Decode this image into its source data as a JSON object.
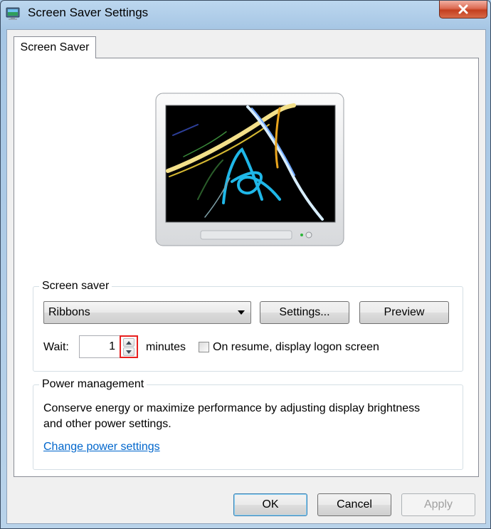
{
  "window": {
    "title": "Screen Saver Settings"
  },
  "tabs": [
    {
      "label": "Screen Saver"
    }
  ],
  "screen_saver": {
    "group_title": "Screen saver",
    "selected": "Ribbons",
    "settings_label": "Settings...",
    "preview_label": "Preview",
    "wait_label": "Wait:",
    "wait_value": "1",
    "minutes_label": "minutes",
    "logon_label": "On resume, display logon screen",
    "logon_checked": false
  },
  "power": {
    "group_title": "Power management",
    "description": "Conserve energy or maximize performance by adjusting display brightness and other power settings.",
    "link_label": "Change power settings"
  },
  "buttons": {
    "ok": "OK",
    "cancel": "Cancel",
    "apply": "Apply"
  },
  "colors": {
    "accent_link": "#0066cc",
    "highlight": "#e8201f",
    "close": "#c33f1f"
  }
}
